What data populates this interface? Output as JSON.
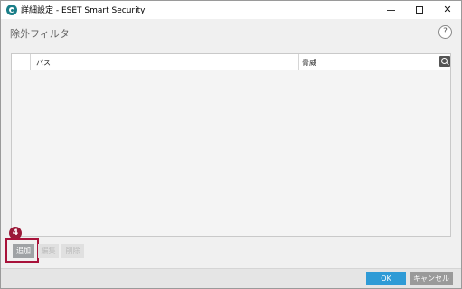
{
  "window": {
    "title": "詳細設定 - ESET Smart Security"
  },
  "header": {
    "title": "除外フィルタ",
    "help_label": "?"
  },
  "table": {
    "columns": [
      "パス",
      "脅威"
    ],
    "rows": []
  },
  "actions": {
    "add_label": "追加",
    "edit_label": "編集",
    "delete_label": "削除"
  },
  "annotation": {
    "step_number": "4"
  },
  "footer": {
    "ok_label": "OK",
    "cancel_label": "キャンセル"
  },
  "colors": {
    "accent": "#2f9bd6",
    "annotation": "#a8123a",
    "brand": "#1a7e88"
  }
}
